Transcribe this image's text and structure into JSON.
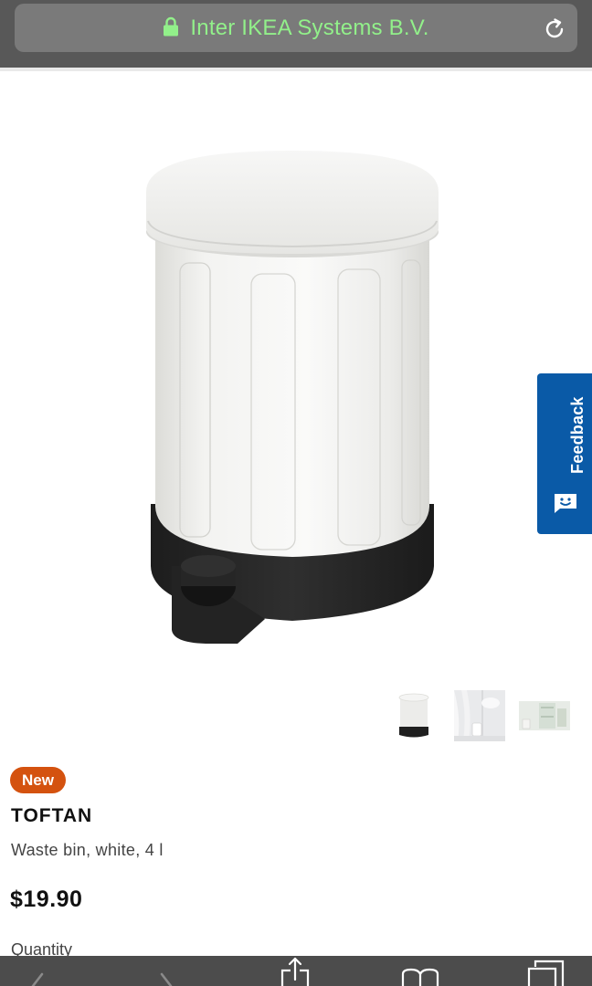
{
  "browser": {
    "site_name": "Inter IKEA Systems B.V.",
    "lock_icon": "lock-icon",
    "reload_icon": "reload-icon"
  },
  "feedback": {
    "label": "Feedback",
    "icon": "smiley-chat-icon"
  },
  "product": {
    "badge": "New",
    "name": "TOFTAN",
    "description": "Waste bin, white, 4 l",
    "price": "$19.90",
    "quantity_label": "Quantity"
  },
  "colors": {
    "address_text": "#92f08a",
    "feedback_blue": "#0a5aa7",
    "badge_orange": "#d4520f",
    "toolbar_bg": "#4c4c4c"
  },
  "toolbar": {
    "icons": [
      "back-icon",
      "forward-icon",
      "share-icon",
      "bookmarks-icon",
      "tabs-icon"
    ]
  }
}
